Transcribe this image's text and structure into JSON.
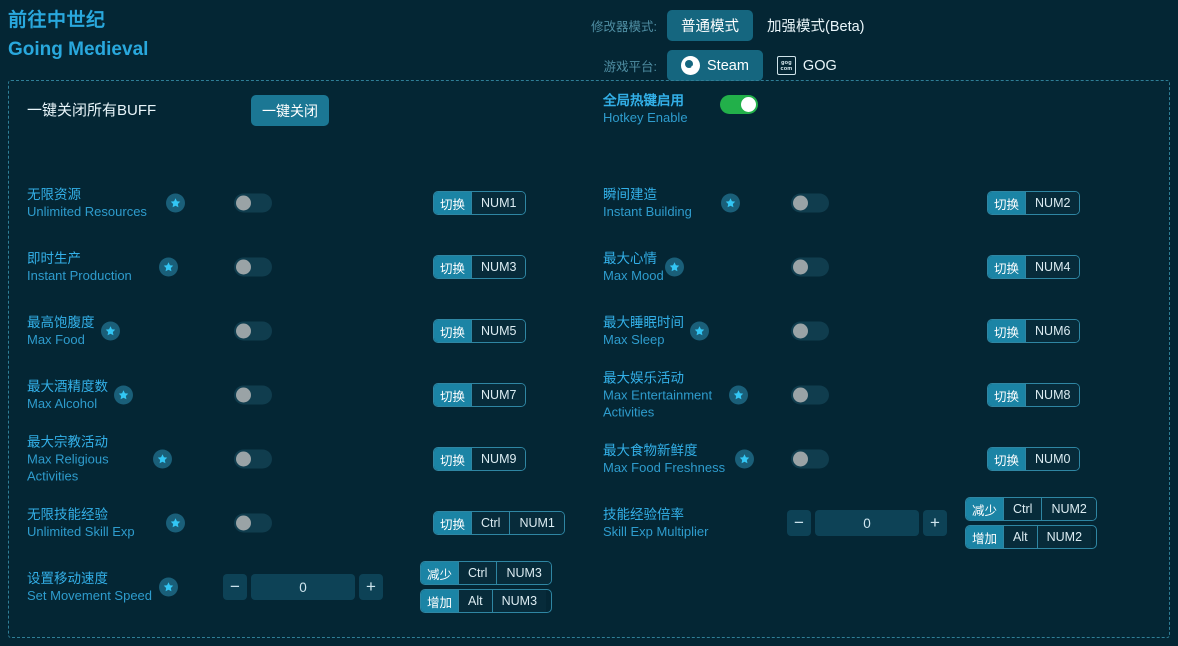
{
  "app": {
    "title_cn": "前往中世纪",
    "title_en": "Going Medieval"
  },
  "header": {
    "mode_label": "修改器模式:",
    "mode_normal": "普通模式",
    "mode_enhanced": "加强模式(Beta)",
    "platform_label": "游戏平台:",
    "platform_steam": "Steam",
    "platform_gog": "GOG",
    "gog_icon_top": "gog",
    "gog_icon_bottom": "com"
  },
  "topbar": {
    "close_all_label": "一键关闭所有BUFF",
    "close_all_button": "一键关闭",
    "hotkey_enable_cn": "全局热键启用",
    "hotkey_enable_en": "Hotkey Enable",
    "hotkey_enable_state": "on"
  },
  "actions": {
    "toggle": "切换",
    "decrease": "减少",
    "increase": "增加"
  },
  "left_rows": [
    {
      "cn": "无限资源",
      "en": "Unlimited Resources",
      "star": true,
      "toggle": "off",
      "hotkey": {
        "action": "切换",
        "keys": [
          "NUM1"
        ]
      }
    },
    {
      "cn": "即时生产",
      "en": "Instant Production",
      "star": true,
      "toggle": "off",
      "hotkey": {
        "action": "切换",
        "keys": [
          "NUM3"
        ]
      }
    },
    {
      "cn": "最高饱腹度",
      "en": "Max Food",
      "star": true,
      "toggle": "off",
      "hotkey": {
        "action": "切换",
        "keys": [
          "NUM5"
        ]
      }
    },
    {
      "cn": "最大酒精度数",
      "en": "Max Alcohol",
      "star": true,
      "toggle": "off",
      "hotkey": {
        "action": "切换",
        "keys": [
          "NUM7"
        ]
      }
    },
    {
      "cn": "最大宗教活动",
      "en": "Max Religious Activities",
      "star": true,
      "toggle": "off",
      "hotkey": {
        "action": "切换",
        "keys": [
          "NUM9"
        ]
      }
    },
    {
      "cn": "无限技能经验",
      "en": "Unlimited Skill Exp",
      "star": true,
      "toggle": "off",
      "hotkey": {
        "action": "切换",
        "keys": [
          "Ctrl",
          "NUM1"
        ]
      }
    },
    {
      "cn": "设置移动速度",
      "en": "Set Movement Speed",
      "star": true,
      "stepper_value": "0",
      "hotkeys": [
        {
          "action": "减少",
          "keys": [
            "Ctrl",
            "NUM3"
          ]
        },
        {
          "action": "增加",
          "keys": [
            "Alt",
            "NUM3"
          ]
        }
      ]
    }
  ],
  "right_rows": [
    {
      "cn": "瞬间建造",
      "en": "Instant Building",
      "star": true,
      "toggle": "off",
      "hotkey": {
        "action": "切换",
        "keys": [
          "NUM2"
        ]
      }
    },
    {
      "cn": "最大心情",
      "en": "Max Mood",
      "star": true,
      "toggle": "off",
      "hotkey": {
        "action": "切换",
        "keys": [
          "NUM4"
        ]
      }
    },
    {
      "cn": "最大睡眠时间",
      "en": "Max Sleep",
      "star": true,
      "toggle": "off",
      "hotkey": {
        "action": "切换",
        "keys": [
          "NUM6"
        ]
      }
    },
    {
      "cn": "最大娱乐活动",
      "en": "Max Entertainment Activities",
      "star": true,
      "toggle": "off",
      "hotkey": {
        "action": "切换",
        "keys": [
          "NUM8"
        ]
      }
    },
    {
      "cn": "最大食物新鲜度",
      "en": "Max Food Freshness",
      "star": true,
      "toggle": "off",
      "hotkey": {
        "action": "切换",
        "keys": [
          "NUM0"
        ]
      }
    },
    {
      "cn": "技能经验倍率",
      "en": "Skill Exp Multiplier",
      "star": false,
      "stepper_value": "0",
      "hotkeys": [
        {
          "action": "减少",
          "keys": [
            "Ctrl",
            "NUM2"
          ]
        },
        {
          "action": "增加",
          "keys": [
            "Alt",
            "NUM2"
          ]
        }
      ]
    }
  ],
  "stepper": {
    "minus": "−",
    "plus": "+"
  },
  "colors": {
    "background": "#042634",
    "accent": "#33b0e8",
    "button": "#1b7794",
    "toggle_on": "#22b04a",
    "toggle_off": "#103d4e",
    "border": "#2f7e96"
  }
}
